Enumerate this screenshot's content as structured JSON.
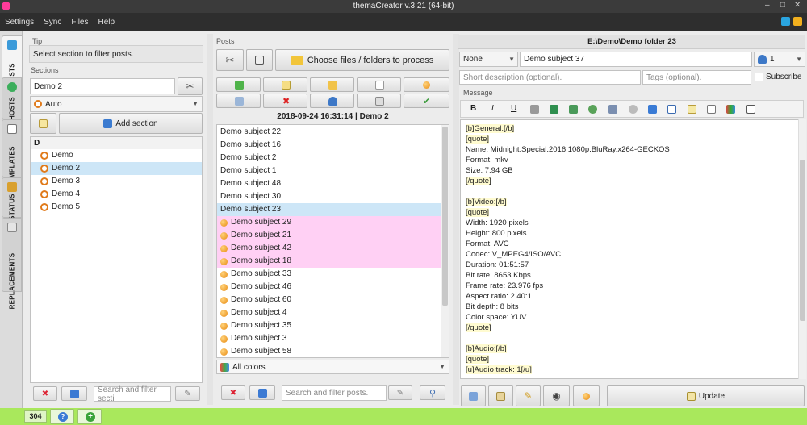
{
  "window": {
    "title": "themaCreator v.3.21  (64-bit)",
    "controls": [
      "–",
      "□",
      "✕"
    ]
  },
  "menu": [
    "Settings",
    "Sync",
    "Files",
    "Help"
  ],
  "vtabs": [
    "POSTS",
    "HOSTS",
    "TEMPLATES",
    "STATUS",
    "REPLACEMENTS"
  ],
  "tip": {
    "header": "Tip",
    "text": "Select section to filter posts."
  },
  "sections": {
    "header": "Sections",
    "search_value": "Demo 2",
    "mode": "Auto",
    "add_label": "Add section",
    "group": "D",
    "items": [
      "Demo",
      "Demo 2",
      "Demo 3",
      "Demo 4",
      "Demo 5"
    ],
    "selected_index": 1,
    "filter_placeholder": "Search and filter secti"
  },
  "posts": {
    "header": "Posts",
    "choose_label": "Choose files / folders to process",
    "date_header": "2018-09-24 16:31:14 | Demo 2",
    "items": [
      {
        "label": "Demo subject 22",
        "icon": false,
        "state": ""
      },
      {
        "label": "Demo subject 16",
        "icon": false,
        "state": ""
      },
      {
        "label": "Demo subject 2",
        "icon": false,
        "state": ""
      },
      {
        "label": "Demo subject 1",
        "icon": false,
        "state": ""
      },
      {
        "label": "Demo subject 48",
        "icon": false,
        "state": ""
      },
      {
        "label": "Demo subject 30",
        "icon": false,
        "state": ""
      },
      {
        "label": "Demo subject 23",
        "icon": false,
        "state": "selected"
      },
      {
        "label": "Demo subject 29",
        "icon": true,
        "state": "pink"
      },
      {
        "label": "Demo subject 21",
        "icon": true,
        "state": "pink"
      },
      {
        "label": "Demo subject 42",
        "icon": true,
        "state": "pink"
      },
      {
        "label": "Demo subject 18",
        "icon": true,
        "state": "pink"
      },
      {
        "label": "Demo subject 33",
        "icon": true,
        "state": ""
      },
      {
        "label": "Demo subject 46",
        "icon": true,
        "state": ""
      },
      {
        "label": "Demo subject 60",
        "icon": true,
        "state": ""
      },
      {
        "label": "Demo subject 4",
        "icon": true,
        "state": ""
      },
      {
        "label": "Demo subject 35",
        "icon": true,
        "state": ""
      },
      {
        "label": "Demo subject 3",
        "icon": true,
        "state": ""
      },
      {
        "label": "Demo subject 58",
        "icon": true,
        "state": ""
      }
    ],
    "color_filter": "All colors",
    "filter_placeholder": "Search and filter posts."
  },
  "editor": {
    "path": "E:\\Demo\\Demo folder 23",
    "host_select": "None",
    "subject": "Demo subject 37",
    "user_count": "1",
    "desc_placeholder": "Short description (optional).",
    "tags_placeholder": "Tags (optional).",
    "subscribe_label": "Subscribe",
    "message_header": "Message",
    "message_lines": [
      "[b]General:[/b]",
      "[quote]",
      "Name: Midnight.Special.2016.1080p.BluRay.x264-GECKOS",
      "Format: mkv",
      "Size: 7.94 GB",
      "[/quote]",
      "",
      "[b]Video:[/b]",
      "[quote]",
      "Width: 1920 pixels",
      "Height: 800 pixels",
      "Format: AVC",
      "Codec: V_MPEG4/ISO/AVC",
      "Duration: 01:51:57",
      "Bit rate: 8653 Kbps",
      "Frame rate: 23.976 fps",
      "Aspect ratio: 2.40:1",
      "Bit depth: 8 bits",
      "Color space: YUV",
      "[/quote]",
      "",
      "[b]Audio:[/b]",
      "[quote]",
      "[u]Audio track: 1[/u]"
    ],
    "update_label": "Update"
  },
  "status": {
    "count": "304"
  },
  "colors": {
    "status_bar": "#a9e85c",
    "pink_row": "#ffd0f4",
    "selected_row": "#cde6f7"
  }
}
